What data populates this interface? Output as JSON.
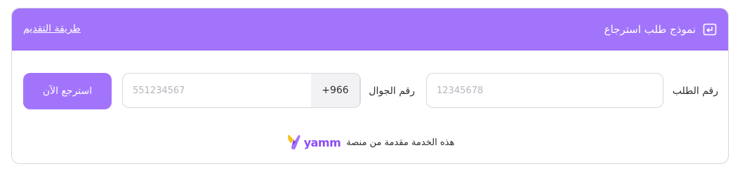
{
  "header": {
    "title": "نموذج طلب استرجاع",
    "help_link": "طريقة التقديم",
    "icon": "return-arrow-icon"
  },
  "form": {
    "order_label": "رقم الطلب",
    "order_placeholder": "12345678",
    "phone_label": "رقم الجوال",
    "phone_placeholder": "551234567",
    "country_code": "+966",
    "submit_label": "استرجع الآن"
  },
  "footer": {
    "text": "هذه الخدمة مقدمة من منصة",
    "brand_name": "yamm",
    "brand_icon": "yamm-logo-icon"
  },
  "colors": {
    "accent": "#a274fb",
    "brand": "#8b4ef5",
    "border": "#d8d8de"
  }
}
